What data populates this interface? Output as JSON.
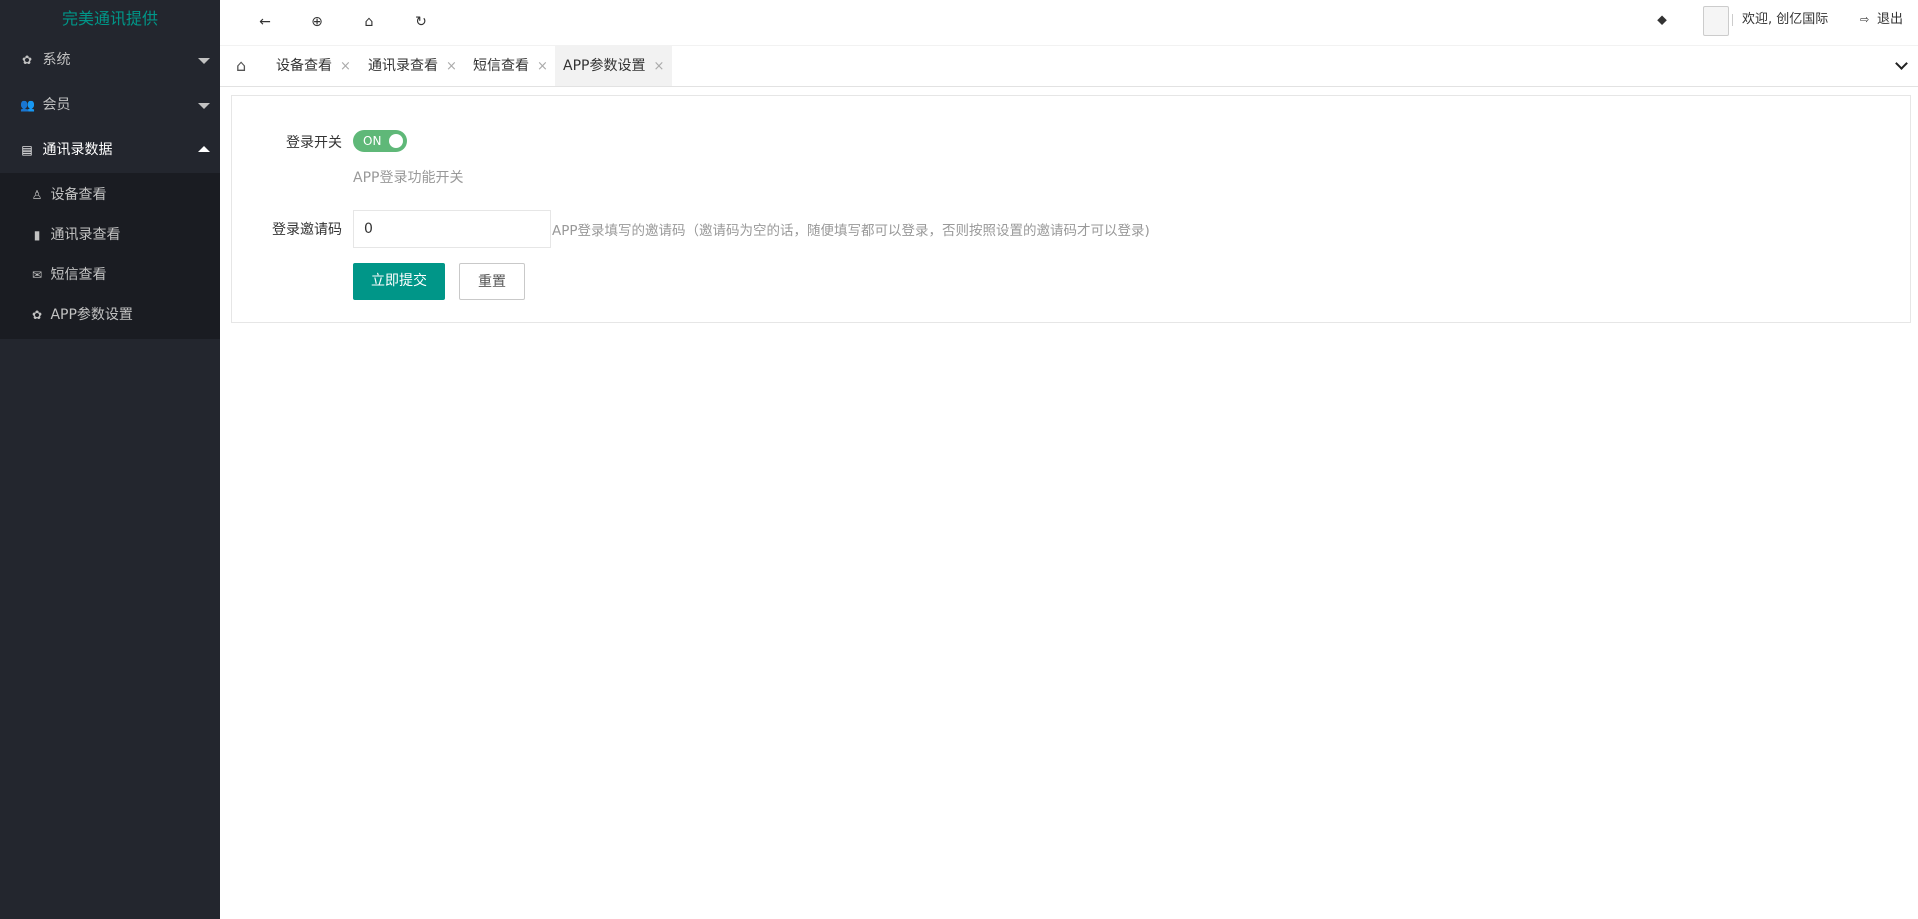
{
  "sidebar": {
    "logo": "完美通讯提供",
    "items": [
      {
        "label": "系统",
        "icon": "gear-icon",
        "glyph": "✿"
      },
      {
        "label": "会员",
        "icon": "users-icon",
        "glyph": "👥"
      },
      {
        "label": "通讯录数据",
        "icon": "id-card-icon",
        "glyph": "▤"
      }
    ],
    "subitems": [
      {
        "label": "设备查看",
        "icon": "user-outline-icon",
        "glyph": "♙"
      },
      {
        "label": "通讯录查看",
        "icon": "book-icon",
        "glyph": "▮"
      },
      {
        "label": "短信查看",
        "icon": "envelope-icon",
        "glyph": "✉"
      },
      {
        "label": "APP参数设置",
        "icon": "gear-icon",
        "glyph": "✿"
      }
    ]
  },
  "header": {
    "icons": [
      {
        "name": "back-icon",
        "glyph": "←"
      },
      {
        "name": "fullscreen-icon",
        "glyph": "⊕"
      },
      {
        "name": "bank-icon",
        "glyph": "⌂"
      },
      {
        "name": "refresh-icon",
        "glyph": "↻"
      }
    ],
    "tag_glyph": "⬥",
    "welcome": "欢迎, 创亿国际",
    "logout": "退出",
    "logout_glyph": "⇨"
  },
  "tabs": {
    "home_glyph": "⌂",
    "items": [
      {
        "label": "设备查看"
      },
      {
        "label": "通讯录查看"
      },
      {
        "label": "短信查看"
      },
      {
        "label": "APP参数设置"
      }
    ],
    "close_glyph": "×"
  },
  "form": {
    "login_switch": {
      "label": "登录开关",
      "state": "ON",
      "aux": "APP登录功能开关"
    },
    "invite_code": {
      "label": "登录邀请码",
      "value": "0",
      "aux": "APP登录填写的邀请码（邀请码为空的话，随便填写都可以登录，否则按照设置的邀请码才可以登录)"
    },
    "submit_label": "立即提交",
    "reset_label": "重置"
  },
  "colors": {
    "sidebar_bg": "#23262e",
    "accent": "#009688",
    "switch_on": "#5fb878"
  }
}
